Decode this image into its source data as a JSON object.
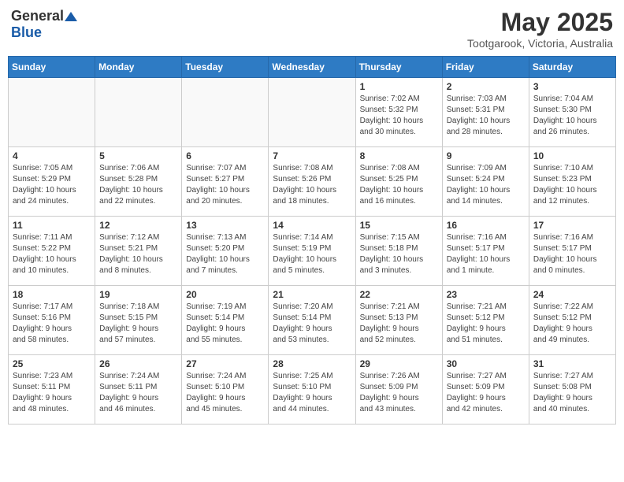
{
  "header": {
    "logo_general": "General",
    "logo_blue": "Blue",
    "title": "May 2025",
    "location": "Tootgarook, Victoria, Australia"
  },
  "weekdays": [
    "Sunday",
    "Monday",
    "Tuesday",
    "Wednesday",
    "Thursday",
    "Friday",
    "Saturday"
  ],
  "weeks": [
    [
      {
        "day": "",
        "info": ""
      },
      {
        "day": "",
        "info": ""
      },
      {
        "day": "",
        "info": ""
      },
      {
        "day": "",
        "info": ""
      },
      {
        "day": "1",
        "info": "Sunrise: 7:02 AM\nSunset: 5:32 PM\nDaylight: 10 hours\nand 30 minutes."
      },
      {
        "day": "2",
        "info": "Sunrise: 7:03 AM\nSunset: 5:31 PM\nDaylight: 10 hours\nand 28 minutes."
      },
      {
        "day": "3",
        "info": "Sunrise: 7:04 AM\nSunset: 5:30 PM\nDaylight: 10 hours\nand 26 minutes."
      }
    ],
    [
      {
        "day": "4",
        "info": "Sunrise: 7:05 AM\nSunset: 5:29 PM\nDaylight: 10 hours\nand 24 minutes."
      },
      {
        "day": "5",
        "info": "Sunrise: 7:06 AM\nSunset: 5:28 PM\nDaylight: 10 hours\nand 22 minutes."
      },
      {
        "day": "6",
        "info": "Sunrise: 7:07 AM\nSunset: 5:27 PM\nDaylight: 10 hours\nand 20 minutes."
      },
      {
        "day": "7",
        "info": "Sunrise: 7:08 AM\nSunset: 5:26 PM\nDaylight: 10 hours\nand 18 minutes."
      },
      {
        "day": "8",
        "info": "Sunrise: 7:08 AM\nSunset: 5:25 PM\nDaylight: 10 hours\nand 16 minutes."
      },
      {
        "day": "9",
        "info": "Sunrise: 7:09 AM\nSunset: 5:24 PM\nDaylight: 10 hours\nand 14 minutes."
      },
      {
        "day": "10",
        "info": "Sunrise: 7:10 AM\nSunset: 5:23 PM\nDaylight: 10 hours\nand 12 minutes."
      }
    ],
    [
      {
        "day": "11",
        "info": "Sunrise: 7:11 AM\nSunset: 5:22 PM\nDaylight: 10 hours\nand 10 minutes."
      },
      {
        "day": "12",
        "info": "Sunrise: 7:12 AM\nSunset: 5:21 PM\nDaylight: 10 hours\nand 8 minutes."
      },
      {
        "day": "13",
        "info": "Sunrise: 7:13 AM\nSunset: 5:20 PM\nDaylight: 10 hours\nand 7 minutes."
      },
      {
        "day": "14",
        "info": "Sunrise: 7:14 AM\nSunset: 5:19 PM\nDaylight: 10 hours\nand 5 minutes."
      },
      {
        "day": "15",
        "info": "Sunrise: 7:15 AM\nSunset: 5:18 PM\nDaylight: 10 hours\nand 3 minutes."
      },
      {
        "day": "16",
        "info": "Sunrise: 7:16 AM\nSunset: 5:17 PM\nDaylight: 10 hours\nand 1 minute."
      },
      {
        "day": "17",
        "info": "Sunrise: 7:16 AM\nSunset: 5:17 PM\nDaylight: 10 hours\nand 0 minutes."
      }
    ],
    [
      {
        "day": "18",
        "info": "Sunrise: 7:17 AM\nSunset: 5:16 PM\nDaylight: 9 hours\nand 58 minutes."
      },
      {
        "day": "19",
        "info": "Sunrise: 7:18 AM\nSunset: 5:15 PM\nDaylight: 9 hours\nand 57 minutes."
      },
      {
        "day": "20",
        "info": "Sunrise: 7:19 AM\nSunset: 5:14 PM\nDaylight: 9 hours\nand 55 minutes."
      },
      {
        "day": "21",
        "info": "Sunrise: 7:20 AM\nSunset: 5:14 PM\nDaylight: 9 hours\nand 53 minutes."
      },
      {
        "day": "22",
        "info": "Sunrise: 7:21 AM\nSunset: 5:13 PM\nDaylight: 9 hours\nand 52 minutes."
      },
      {
        "day": "23",
        "info": "Sunrise: 7:21 AM\nSunset: 5:12 PM\nDaylight: 9 hours\nand 51 minutes."
      },
      {
        "day": "24",
        "info": "Sunrise: 7:22 AM\nSunset: 5:12 PM\nDaylight: 9 hours\nand 49 minutes."
      }
    ],
    [
      {
        "day": "25",
        "info": "Sunrise: 7:23 AM\nSunset: 5:11 PM\nDaylight: 9 hours\nand 48 minutes."
      },
      {
        "day": "26",
        "info": "Sunrise: 7:24 AM\nSunset: 5:11 PM\nDaylight: 9 hours\nand 46 minutes."
      },
      {
        "day": "27",
        "info": "Sunrise: 7:24 AM\nSunset: 5:10 PM\nDaylight: 9 hours\nand 45 minutes."
      },
      {
        "day": "28",
        "info": "Sunrise: 7:25 AM\nSunset: 5:10 PM\nDaylight: 9 hours\nand 44 minutes."
      },
      {
        "day": "29",
        "info": "Sunrise: 7:26 AM\nSunset: 5:09 PM\nDaylight: 9 hours\nand 43 minutes."
      },
      {
        "day": "30",
        "info": "Sunrise: 7:27 AM\nSunset: 5:09 PM\nDaylight: 9 hours\nand 42 minutes."
      },
      {
        "day": "31",
        "info": "Sunrise: 7:27 AM\nSunset: 5:08 PM\nDaylight: 9 hours\nand 40 minutes."
      }
    ]
  ]
}
